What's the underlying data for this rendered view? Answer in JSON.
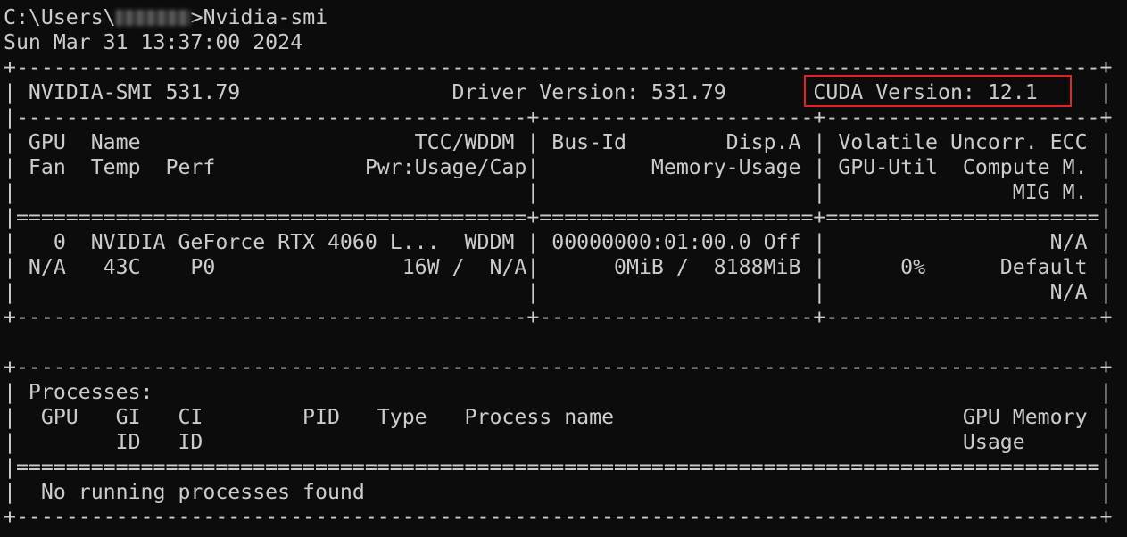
{
  "window": {
    "prompt_prefix": "C:\\Users\\",
    "prompt_suffix": ">Nvidia-smi",
    "timestamp": "Sun Mar 31 13:37:00 2024"
  },
  "output": {
    "lines": [
      "+---------------------------------------------------------------------------------------+",
      "| NVIDIA-SMI 531.79                 Driver Version: 531.79       CUDA Version: 12.1     |",
      "|-----------------------------------------+----------------------+----------------------+",
      "| GPU  Name                      TCC/WDDM | Bus-Id        Disp.A | Volatile Uncorr. ECC |",
      "| Fan  Temp  Perf            Pwr:Usage/Cap|         Memory-Usage | GPU-Util  Compute M. |",
      "|                                         |                      |               MIG M. |",
      "|=========================================+======================+======================|",
      "|   0  NVIDIA GeForce RTX 4060 L...  WDDM | 00000000:01:00.0 Off |                  N/A |",
      "| N/A   43C    P0               16W /  N/A|      0MiB /  8188MiB |      0%      Default |",
      "|                                         |                      |                  N/A |",
      "+-----------------------------------------+----------------------+----------------------+",
      "",
      "+---------------------------------------------------------------------------------------+",
      "| Processes:                                                                            |",
      "|  GPU   GI   CI        PID   Type   Process name                            GPU Memory |",
      "|        ID   ID                                                             Usage      |",
      "|=======================================================================================|",
      "|  No running processes found                                                           |",
      "+---------------------------------------------------------------------------------------+"
    ]
  },
  "colors": {
    "background": "#0c0c0c",
    "text": "#cccccc",
    "highlight_border": "#e02424"
  }
}
